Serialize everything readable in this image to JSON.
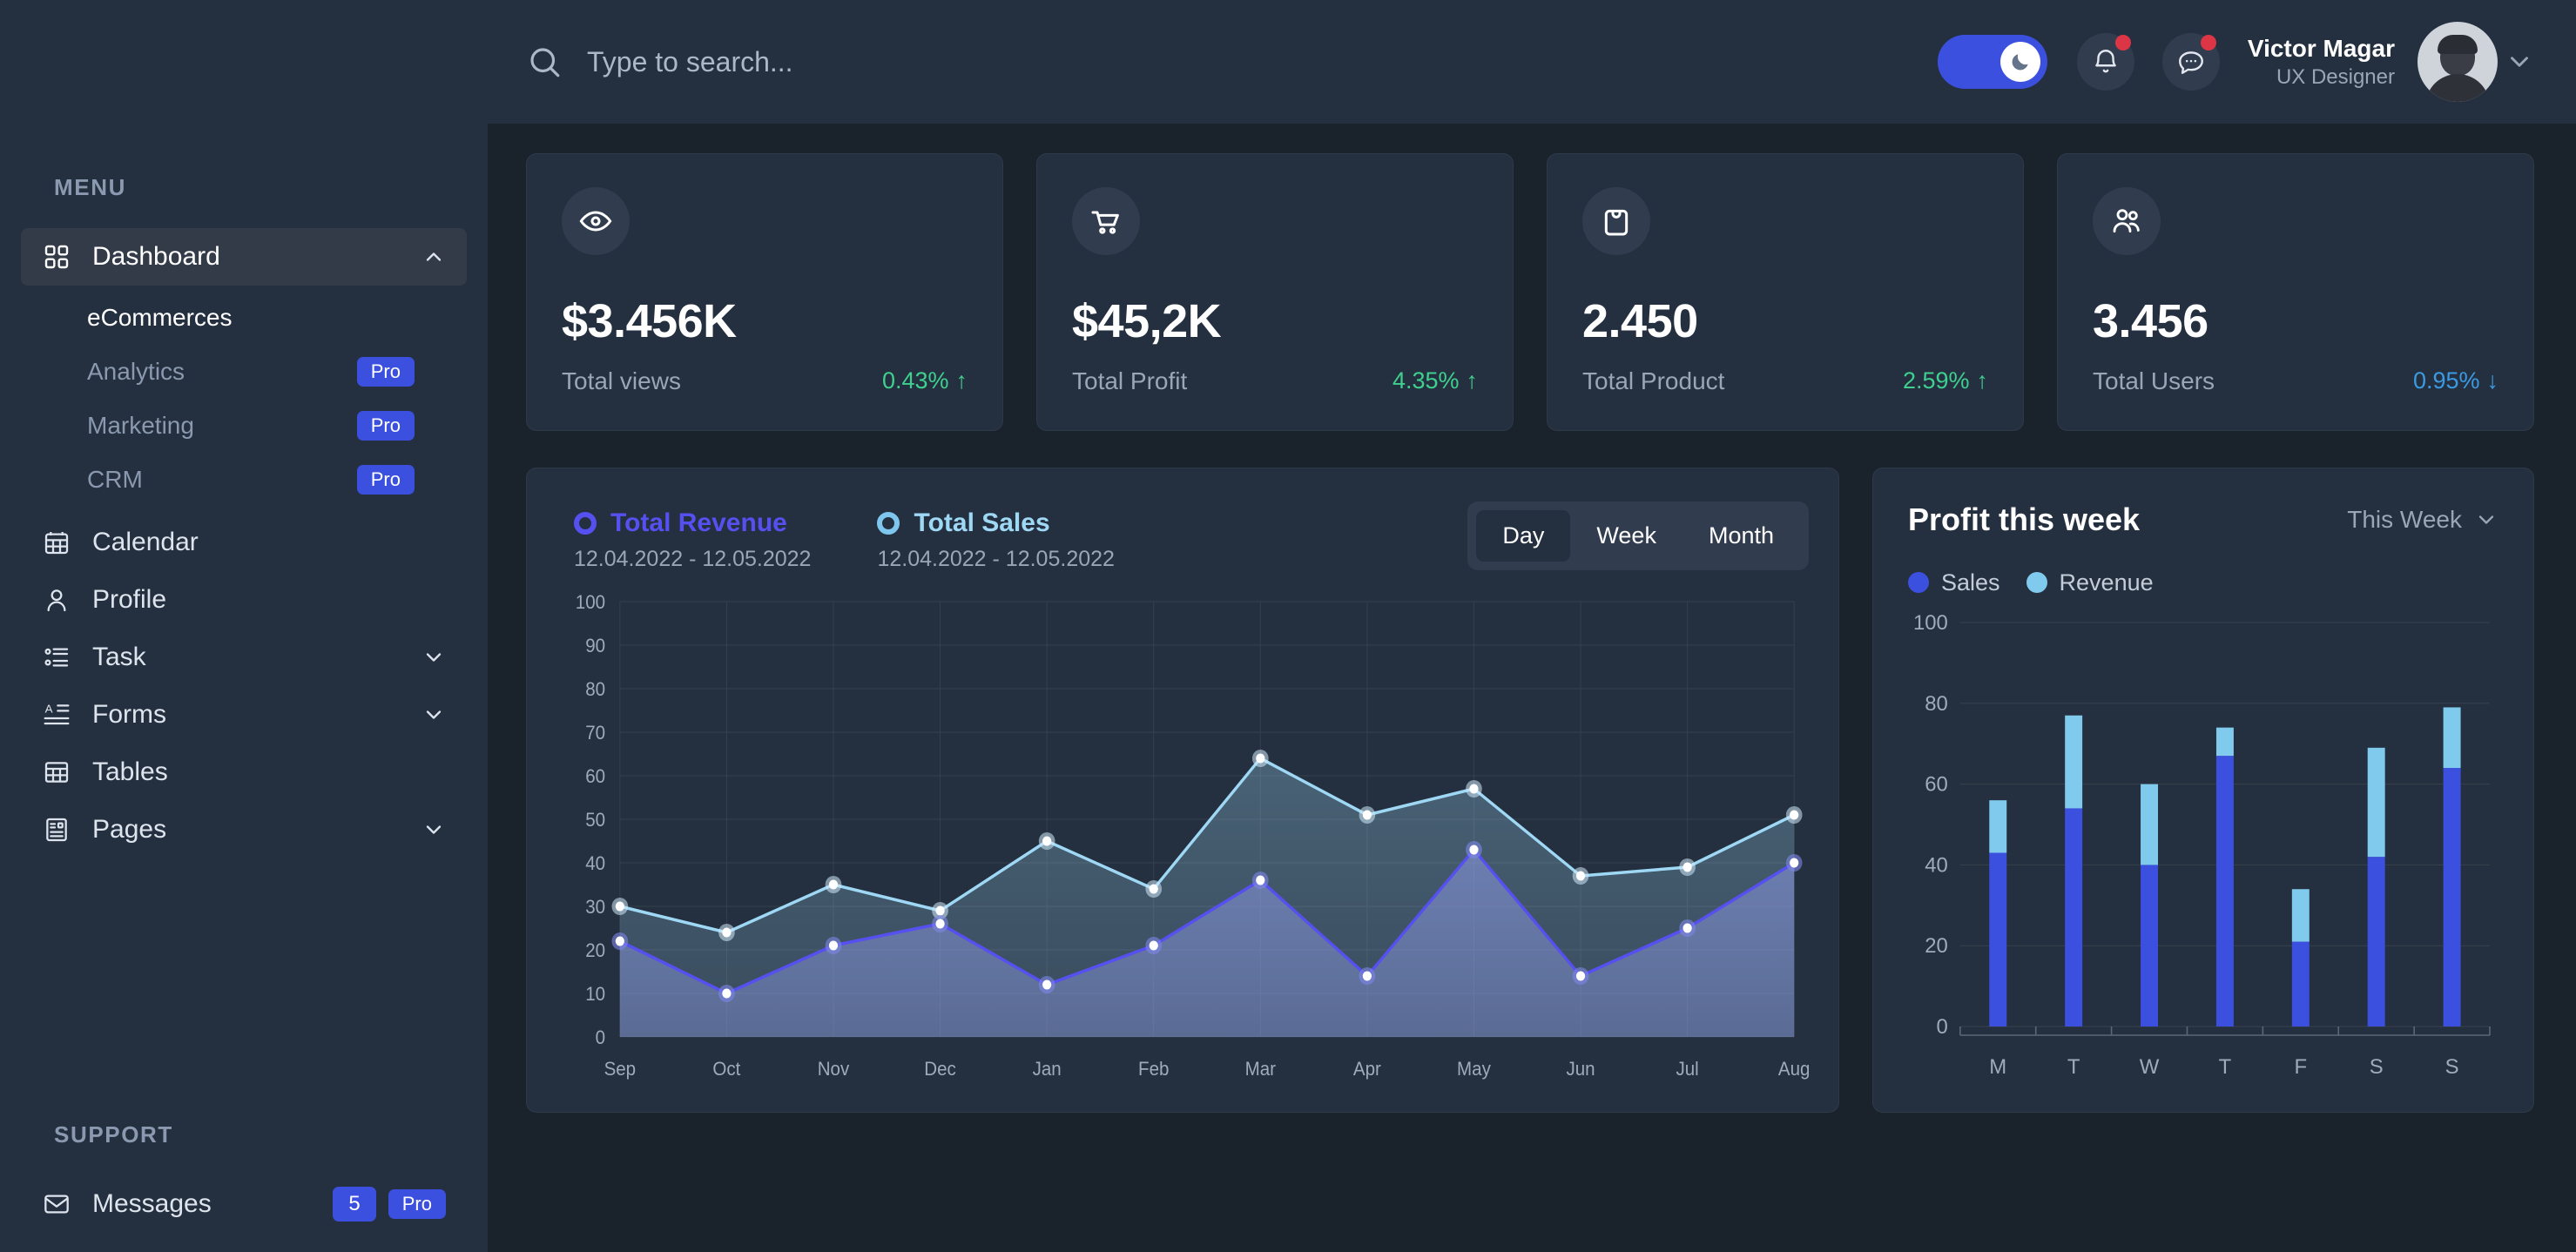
{
  "sidebar": {
    "menu_heading": "MENU",
    "support_heading": "SUPPORT",
    "nav": [
      {
        "label": "Dashboard",
        "icon": "grid-icon",
        "active": true,
        "chevron": "chevron-up-icon"
      },
      {
        "label": "Calendar",
        "icon": "calendar-icon"
      },
      {
        "label": "Profile",
        "icon": "user-icon"
      },
      {
        "label": "Task",
        "icon": "task-list-icon",
        "chevron": "chevron-down-icon"
      },
      {
        "label": "Forms",
        "icon": "forms-icon",
        "chevron": "chevron-down-icon"
      },
      {
        "label": "Tables",
        "icon": "table-icon"
      },
      {
        "label": "Pages",
        "icon": "pages-icon",
        "chevron": "chevron-down-icon"
      }
    ],
    "dashboard_submenu": [
      {
        "label": "eCommerces",
        "active": true,
        "badge": ""
      },
      {
        "label": "Analytics",
        "badge": "Pro"
      },
      {
        "label": "Marketing",
        "badge": "Pro"
      },
      {
        "label": "CRM",
        "badge": "Pro"
      }
    ],
    "support": [
      {
        "label": "Messages",
        "icon": "mail-icon",
        "count": "5",
        "badge": "Pro"
      }
    ]
  },
  "header": {
    "search": {
      "placeholder": "Type to search...",
      "value": "",
      "icon": "search-icon"
    },
    "dark_mode_toggle": {
      "icon": "moon-icon",
      "state": "on"
    },
    "notifications": {
      "icon": "bell-icon",
      "has_unread": true
    },
    "messages": {
      "icon": "chat-bubble-icon",
      "has_unread": true
    },
    "user": {
      "name": "Victor Magar",
      "role": "UX Designer",
      "chevron": "chevron-down-icon"
    }
  },
  "stats": [
    {
      "icon": "eye-icon",
      "value": "$3.456K",
      "label": "Total views",
      "delta": "0.43%",
      "direction": "up",
      "arrow": "↑",
      "color": "#3fcf8e"
    },
    {
      "icon": "cart-icon",
      "value": "$45,2K",
      "label": "Total Profit",
      "delta": "4.35%",
      "direction": "up",
      "arrow": "↑",
      "color": "#3fcf8e"
    },
    {
      "icon": "bag-icon",
      "value": "2.450",
      "label": "Total Product",
      "delta": "2.59%",
      "direction": "up",
      "arrow": "↑",
      "color": "#3fcf8e"
    },
    {
      "icon": "users-icon",
      "value": "3.456",
      "label": "Total Users",
      "delta": "0.95%",
      "direction": "down",
      "arrow": "↓",
      "color": "#3b9ae1"
    }
  ],
  "revenue_panel": {
    "series": [
      {
        "name": "Total Revenue",
        "range": "12.04.2022 - 12.05.2022",
        "color": "#5750f1"
      },
      {
        "name": "Total Sales",
        "range": "12.04.2022 - 12.05.2022",
        "color": "#9fd8f5"
      }
    ],
    "segments": [
      {
        "label": "Day",
        "active": true
      },
      {
        "label": "Week",
        "active": false
      },
      {
        "label": "Month",
        "active": false
      }
    ]
  },
  "profit_panel": {
    "title": "Profit this week",
    "select_value": "This Week",
    "select_icon": "chevron-down-icon",
    "legend": [
      {
        "label": "Sales",
        "color": "#3c50e0"
      },
      {
        "label": "Revenue",
        "color": "#80caee"
      }
    ]
  },
  "chart_data": [
    {
      "type": "area",
      "title": "",
      "xlabel": "",
      "ylabel": "",
      "categories": [
        "Sep",
        "Oct",
        "Nov",
        "Dec",
        "Jan",
        "Feb",
        "Mar",
        "Apr",
        "May",
        "Jun",
        "Jul",
        "Aug"
      ],
      "ylim": [
        0,
        100
      ],
      "yticks": [
        0,
        10,
        20,
        30,
        40,
        50,
        60,
        70,
        80,
        90,
        100
      ],
      "grid": true,
      "legend_position": "top-left",
      "series": [
        {
          "name": "Total Sales",
          "color": "#9fd8f5",
          "values": [
            30,
            24,
            35,
            29,
            45,
            34,
            64,
            51,
            57,
            37,
            39,
            51
          ]
        },
        {
          "name": "Total Revenue",
          "color": "#5750f1",
          "values": [
            22,
            10,
            21,
            26,
            12,
            21,
            36,
            14,
            43,
            14,
            25,
            40
          ]
        }
      ]
    },
    {
      "type": "bar",
      "title": "Profit this week",
      "xlabel": "",
      "ylabel": "",
      "stacked": true,
      "categories": [
        "M",
        "T",
        "W",
        "T",
        "F",
        "S",
        "S"
      ],
      "ylim": [
        0,
        100
      ],
      "yticks": [
        0,
        20,
        40,
        60,
        80,
        100
      ],
      "grid": true,
      "legend_position": "top-left",
      "series": [
        {
          "name": "Sales",
          "color": "#3c50e0",
          "values": [
            43,
            54,
            40,
            67,
            21,
            42,
            64
          ]
        },
        {
          "name": "Revenue",
          "color": "#80caee",
          "values": [
            13,
            23,
            20,
            7,
            13,
            27,
            15
          ]
        }
      ]
    }
  ]
}
